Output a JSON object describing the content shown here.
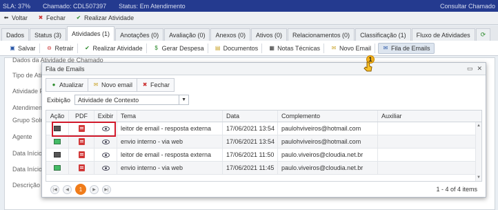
{
  "topbar": {
    "sla": "SLA: 37%",
    "chamado": "Chamado: CDL507397",
    "status": "Status: Em Atendimento",
    "search": "Consultar Chamado"
  },
  "actionbar": {
    "voltar": "Voltar",
    "fechar": "Fechar",
    "realizar": "Realizar Atividade"
  },
  "tabs": [
    {
      "label": "Dados"
    },
    {
      "label": "Status (3)"
    },
    {
      "label": "Atividades (1)"
    },
    {
      "label": "Anotações (0)"
    },
    {
      "label": "Avaliação (0)"
    },
    {
      "label": "Anexos (0)"
    },
    {
      "label": "Ativos (0)"
    },
    {
      "label": "Relacionamentos (0)"
    },
    {
      "label": "Classificação (1)"
    },
    {
      "label": "Fluxo de Atividades"
    }
  ],
  "subbar": {
    "salvar": "Salvar",
    "retrair": "Retrair",
    "realizar": "Realizar Atividade",
    "despesa": "Gerar Despesa",
    "documentos": "Documentos",
    "notas": "Notas Técnicas",
    "novo_email": "Novo Email",
    "fila_emails": "Fila de Emails"
  },
  "background": {
    "fieldset": "Dados da Atividade de Chamado",
    "labels": [
      "Tipo de Ativi",
      "Atividade Pai",
      "Atendimento",
      "Grupo Soluci",
      "Agente",
      "Data Início P",
      "Data Início R",
      "Descrição"
    ]
  },
  "pointer": {
    "badge": "1"
  },
  "dialog": {
    "title": "Fila de Emails",
    "atualizar": "Atualizar",
    "novo_email": "Novo email",
    "fechar": "Fechar",
    "exibicao_label": "Exibição",
    "exibicao_value": "Atividade de Contexto",
    "columns": [
      "Ação",
      "PDF",
      "Exibir",
      "Tema",
      "Data",
      "Complemento",
      "Auxiliar"
    ],
    "rows": [
      {
        "tema": "leitor de email - resposta externa",
        "data": "17/06/2021 13:54",
        "complemento": "paulohviveiros@hotmail.com",
        "auxiliar": ""
      },
      {
        "tema": "envio interno - via web",
        "data": "17/06/2021 13:54",
        "complemento": "paulohviveiros@hotmail.com",
        "auxiliar": ""
      },
      {
        "tema": "leitor de email - resposta externa",
        "data": "17/06/2021 11:50",
        "complemento": "paulo.viveiros@cloudia.net.br",
        "auxiliar": ""
      },
      {
        "tema": "envio interno - via web",
        "data": "17/06/2021 11:45",
        "complemento": "paulo.viveiros@cloudia.net.br",
        "auxiliar": ""
      }
    ],
    "pager": {
      "current": "1",
      "count": "1 - 4 of 4 items"
    }
  }
}
